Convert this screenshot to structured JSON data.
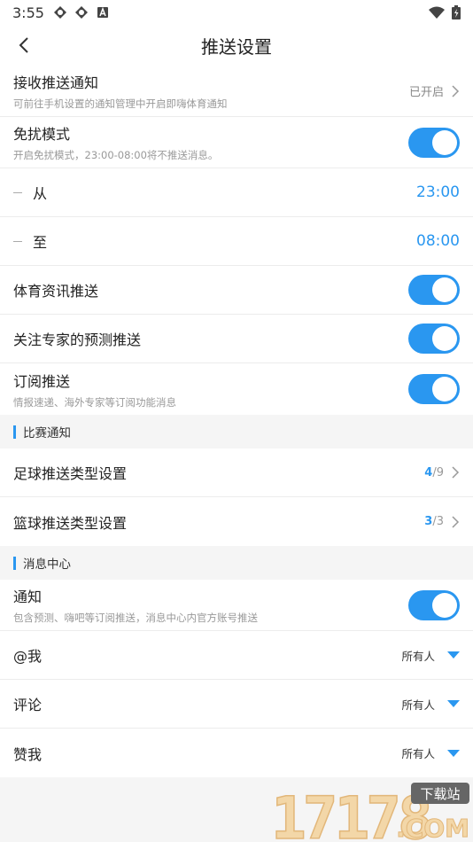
{
  "status_bar": {
    "time": "3:55"
  },
  "header": {
    "title": "推送设置"
  },
  "push": {
    "receive": {
      "label": "接收推送通知",
      "desc": "可前往手机设置的通知管理中开启即嗨体育通知",
      "status": "已开启"
    },
    "dnd": {
      "label": "免扰模式",
      "desc": "开启免扰模式，23:00-08:00将不推送消息。",
      "on": true
    },
    "from": {
      "label": "从",
      "time": "23:00"
    },
    "to": {
      "label": "至",
      "time": "08:00"
    },
    "sports_news": {
      "label": "体育资讯推送",
      "on": true
    },
    "expert_predict": {
      "label": "关注专家的预测推送",
      "on": true
    },
    "subscribe": {
      "label": "订阅推送",
      "desc": "情报速递、海外专家等订阅功能消息",
      "on": true
    }
  },
  "match_section": {
    "title": "比赛通知",
    "football": {
      "label": "足球推送类型设置",
      "selected": "4",
      "total": "/9"
    },
    "basketball": {
      "label": "篮球推送类型设置",
      "selected": "3",
      "total": "/3"
    }
  },
  "message_section": {
    "title": "消息中心",
    "notify": {
      "label": "通知",
      "desc": "包含预测、嗨吧等订阅推送，消息中心内官方账号推送",
      "on": true
    },
    "mention": {
      "label": "@我",
      "value": "所有人"
    },
    "comment": {
      "label": "评论",
      "value": "所有人"
    },
    "like": {
      "label": "赞我",
      "value": "所有人"
    }
  },
  "watermark": {
    "text": "17178",
    "badge": "下载站",
    "domain": ".COM"
  },
  "colors": {
    "accent": "#2a97f0",
    "background": "#f5f5f5"
  }
}
